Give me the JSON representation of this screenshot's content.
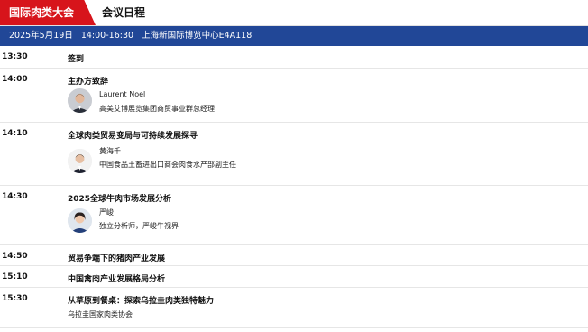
{
  "header": {
    "brand": "国际肉类大会",
    "title": "会议日程"
  },
  "session_info": {
    "date": "2025年5月19日",
    "time": "14:00-16:30",
    "venue": "上海新国际博览中心E4A118"
  },
  "agenda": [
    {
      "time": "13:30",
      "title": "签到"
    },
    {
      "time": "14:00",
      "title": "主办方致辞",
      "speaker": {
        "name": "Laurent Noel",
        "role": "高美艾博展览集团商贸事业群总经理",
        "avatar": "male-suit-avatar"
      }
    },
    {
      "time": "14:10",
      "title": "全球肉类贸易变局与可持续发展探寻",
      "speaker": {
        "name": "黄海千",
        "role": "中国食品土畜进出口商会肉食水产部副主任",
        "avatar": "male-suit-avatar"
      }
    },
    {
      "time": "14:30",
      "title": "2025全球牛肉市场发展分析",
      "speaker": {
        "name": "严峻",
        "role": "独立分析师，严峻牛视界",
        "avatar": "female-avatar"
      }
    },
    {
      "time": "14:50",
      "title": "贸易争端下的猪肉产业发展"
    },
    {
      "time": "15:10",
      "title": "中国禽肉产业发展格局分析"
    },
    {
      "time": "15:30",
      "title": "从草原到餐桌：探索乌拉圭肉类独特魅力",
      "org": "乌拉圭国家肉类协会"
    }
  ],
  "colors": {
    "brand_red": "#d7141b",
    "info_blue": "#214797"
  }
}
